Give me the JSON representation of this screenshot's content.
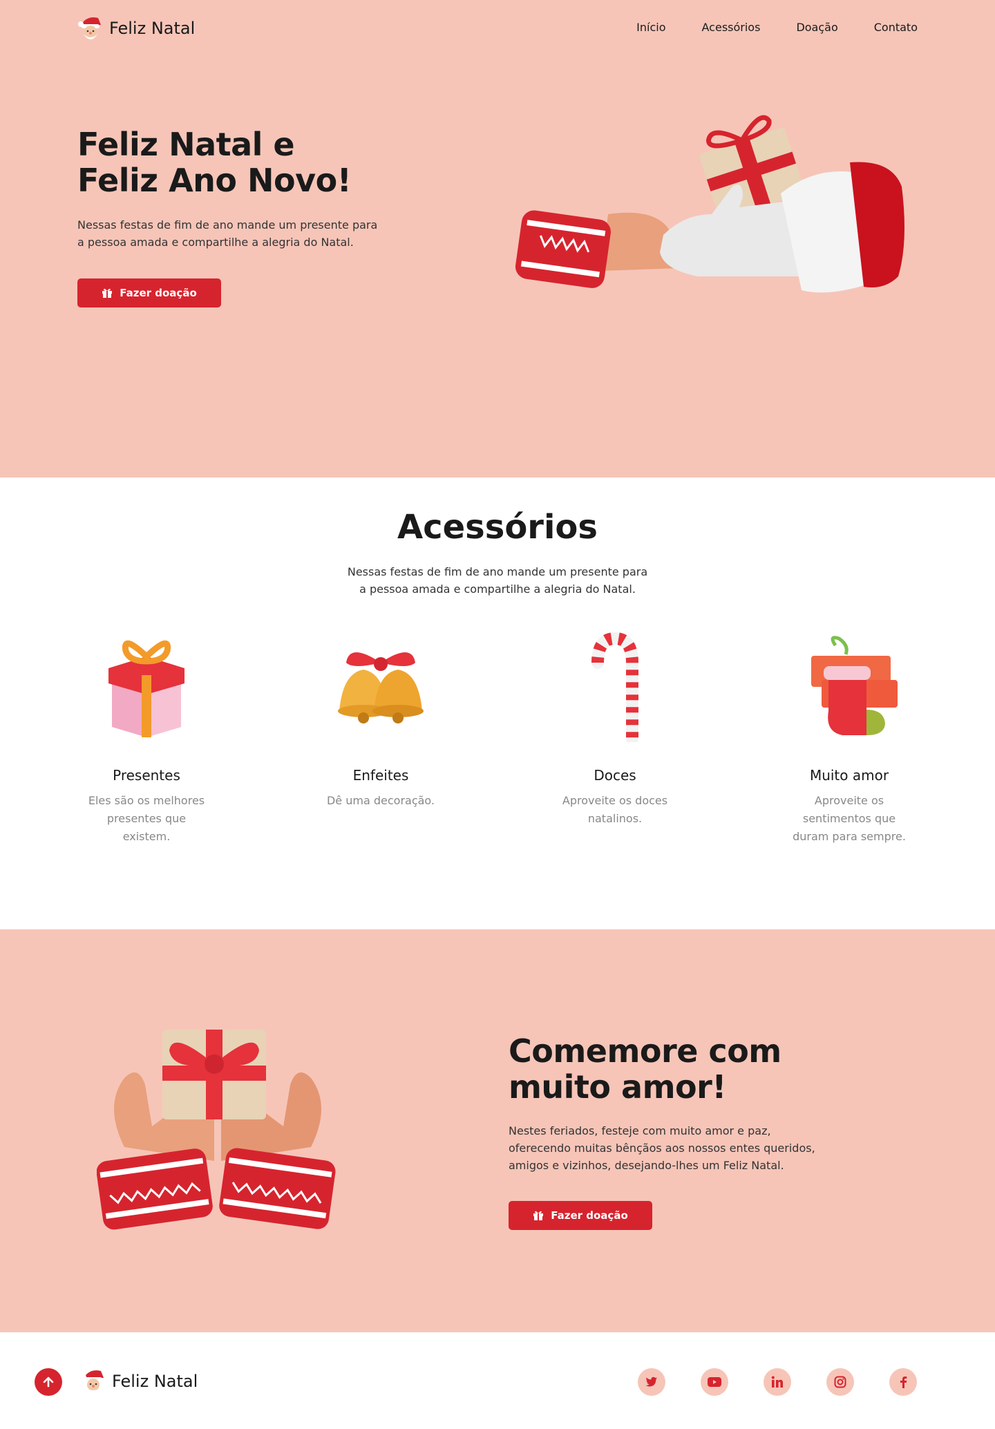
{
  "header": {
    "logo_text": "Feliz Natal",
    "nav": [
      "Início",
      "Acessórios",
      "Doação",
      "Contato"
    ]
  },
  "hero": {
    "title_line1": "Feliz Natal e",
    "title_line2": "Feliz Ano Novo!",
    "text_line1": "Nessas festas de fim de ano mande um presente para",
    "text_line2": "a pessoa amada e compartilhe a alegria do Natal.",
    "button_label": "Fazer doação"
  },
  "accessories": {
    "title": "Acessórios",
    "text_line1": "Nessas festas de fim de ano mande um presente para",
    "text_line2": "a pessoa amada e compartilhe a alegria do Natal.",
    "items": [
      {
        "title": "Presentes",
        "desc": "Eles são os melhores presentes que existem.",
        "icon": "gift-box-icon"
      },
      {
        "title": "Enfeites",
        "desc": "Dê uma decoração.",
        "icon": "bells-icon"
      },
      {
        "title": "Doces",
        "desc": "Aproveite os doces natalinos.",
        "icon": "candy-cane-icon"
      },
      {
        "title": "Muito amor",
        "desc": "Aproveite os sentimentos que duram para sempre.",
        "icon": "stocking-icon"
      }
    ]
  },
  "celebrate": {
    "title_line1": "Comemore com",
    "title_line2": "muito amor!",
    "text_line1": "Nestes feriados, festeje com muito amor e paz,",
    "text_line2": "oferecendo muitas bênçãos aos nossos entes queridos,",
    "text_line3": "amigos e vizinhos, desejando-lhes um Feliz Natal.",
    "button_label": "Fazer doação"
  },
  "footer": {
    "logo_text": "Feliz Natal",
    "socials": [
      "twitter-icon",
      "youtube-icon",
      "linkedin-icon",
      "instagram-icon",
      "facebook-icon"
    ]
  },
  "colors": {
    "pink_bg": "#f6c5b8",
    "accent_red": "#d6242e"
  }
}
